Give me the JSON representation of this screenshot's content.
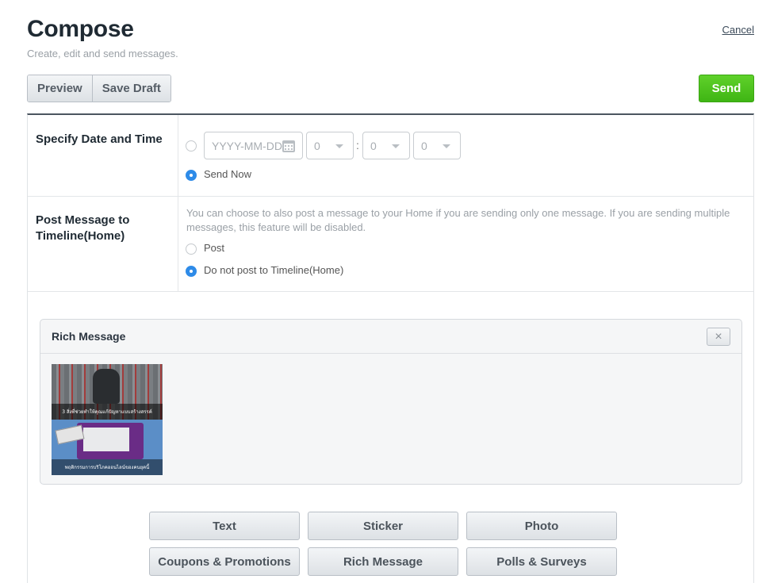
{
  "header": {
    "title": "Compose",
    "subtitle": "Create, edit and send messages.",
    "cancel_label": "Cancel"
  },
  "toolbar": {
    "preview_label": "Preview",
    "save_draft_label": "Save Draft",
    "send_label": "Send"
  },
  "schedule": {
    "label": "Specify Date and Time",
    "date_placeholder": "YYYY-MM-DD",
    "hour": "0",
    "minute": "0",
    "second": "0",
    "time_separator": ":",
    "send_now_label": "Send Now",
    "selected": "send_now"
  },
  "timeline": {
    "label": "Post Message to Timeline(Home)",
    "description": "You can choose to also post a message to your Home if you are sending only one message. If you are sending multiple messages, this feature will be disabled.",
    "post_label": "Post",
    "no_post_label": "Do not post to Timeline(Home)",
    "selected": "no_post"
  },
  "rich_message": {
    "title": "Rich Message",
    "close_label": "×",
    "thumbnail_caption_top": "3 สิ่งที่ช่วยทำให้คุณแก้ปัญหาแบบสร้างสรรค์",
    "thumbnail_caption_bottom": "พฤติกรรมการบริโภคออนไลน์ของคนยุคนี้"
  },
  "message_types": [
    "Text",
    "Sticker",
    "Photo",
    "Coupons & Promotions",
    "Rich Message",
    "Polls & Surveys"
  ],
  "colors": {
    "send_green": "#3fb514",
    "radio_blue": "#2e8be8",
    "panel_border": "#4b5560"
  }
}
